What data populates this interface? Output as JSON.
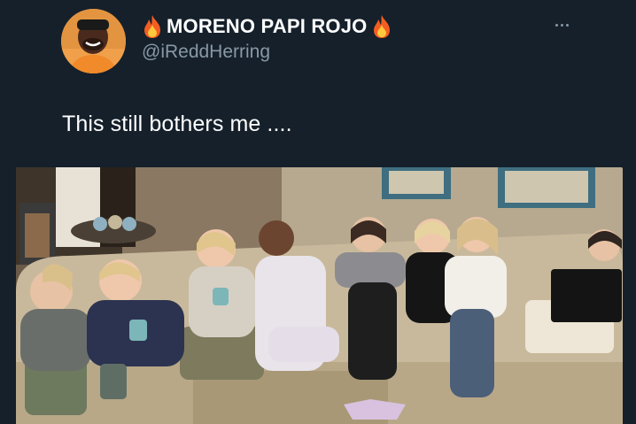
{
  "tweet": {
    "author": {
      "display_name": "MORENO PAPI ROJO",
      "handle": "@iReddHerring",
      "name_emoji_icon": "fire-icon"
    },
    "text": "This still bothers me ....",
    "more_icon": "more-horizontal-icon",
    "media": {
      "type": "photo",
      "alt": ""
    }
  },
  "colors": {
    "background": "#15202b",
    "primary_text": "#ffffff",
    "secondary_text": "#8899a6"
  }
}
